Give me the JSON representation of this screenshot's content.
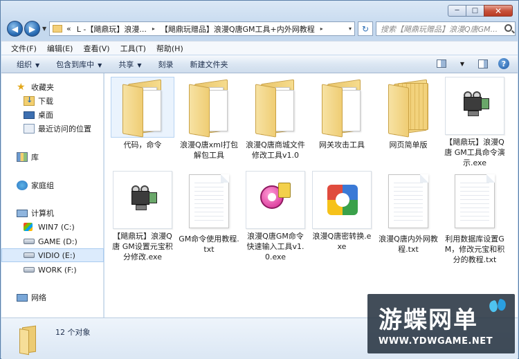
{
  "window": {
    "controls": {
      "minimize": "─",
      "maximize": "□",
      "close": "✕"
    }
  },
  "nav": {
    "back_icon": "arrow-left-icon",
    "forward_icon": "arrow-right-icon",
    "address": {
      "prefix": "«",
      "crumbs": [
        "L -【飓鼎玩】浪漫...",
        "【飓鼎玩赠品】浪漫Q唐GM工具+内外网教程"
      ],
      "separator": "▸",
      "dropdown": "▾"
    },
    "refresh_icon": "↻",
    "search_placeholder": "搜索【飓鼎玩赠品】浪漫Q唐GM..."
  },
  "menubar": [
    {
      "label": "文件(F)"
    },
    {
      "label": "编辑(E)"
    },
    {
      "label": "查看(V)"
    },
    {
      "label": "工具(T)"
    },
    {
      "label": "帮助(H)"
    }
  ],
  "toolbar": {
    "items": [
      {
        "label": "组织",
        "has_arrow": true
      },
      {
        "label": "包含到库中",
        "has_arrow": true
      },
      {
        "label": "共享",
        "has_arrow": true
      },
      {
        "label": "刻录",
        "has_arrow": false
      },
      {
        "label": "新建文件夹",
        "has_arrow": false
      }
    ],
    "arrow": "▼",
    "help": "?"
  },
  "sidebar": {
    "favorites": "收藏夹",
    "downloads": "下载",
    "desktop": "桌面",
    "recent": "最近访问的位置",
    "libraries": "库",
    "homegroup": "家庭组",
    "computer": "计算机",
    "drives": [
      {
        "label": "WIN7 (C:)",
        "icon": "windows-drive-icon"
      },
      {
        "label": "GAME (D:)",
        "icon": "drive-icon"
      },
      {
        "label": "VIDIO (E:)",
        "icon": "drive-icon",
        "selected": true
      },
      {
        "label": "WORK (F:)",
        "icon": "drive-icon"
      }
    ],
    "network": "网络"
  },
  "files": [
    {
      "name": "代码，命令",
      "type": "folder-docs",
      "selected": true
    },
    {
      "name": "浪漫Q唐xml打包解包工具",
      "type": "folder-docs"
    },
    {
      "name": "浪漫Q唐商城文件修改工具v1.0",
      "type": "folder-docs"
    },
    {
      "name": "网关攻击工具",
      "type": "folder-docs"
    },
    {
      "name": "网页简单版",
      "type": "folder-sheets"
    },
    {
      "name": "【飓鼎玩】浪漫Q唐 GM工具命令演示.exe",
      "type": "exe-camera"
    },
    {
      "name": "【飓鼎玩】浪漫Q唐 GM设置元宝积分修改.exe",
      "type": "exe-camera"
    },
    {
      "name": "GM命令使用教程.txt",
      "type": "txt"
    },
    {
      "name": "浪漫Q唐GM命令快速输入工具v1.0.exe",
      "type": "exe-q"
    },
    {
      "name": "浪漫Q唐密转换.exe",
      "type": "exe-g"
    },
    {
      "name": "浪漫Q唐内外网教程.txt",
      "type": "txt"
    },
    {
      "name": "利用数据库设置GM，修改元宝和积分的教程.txt",
      "type": "txt"
    }
  ],
  "status": {
    "count": "12 个对象"
  },
  "watermark": {
    "title": "游蝶网单",
    "url": "WWW.YDWGAME.NET"
  }
}
